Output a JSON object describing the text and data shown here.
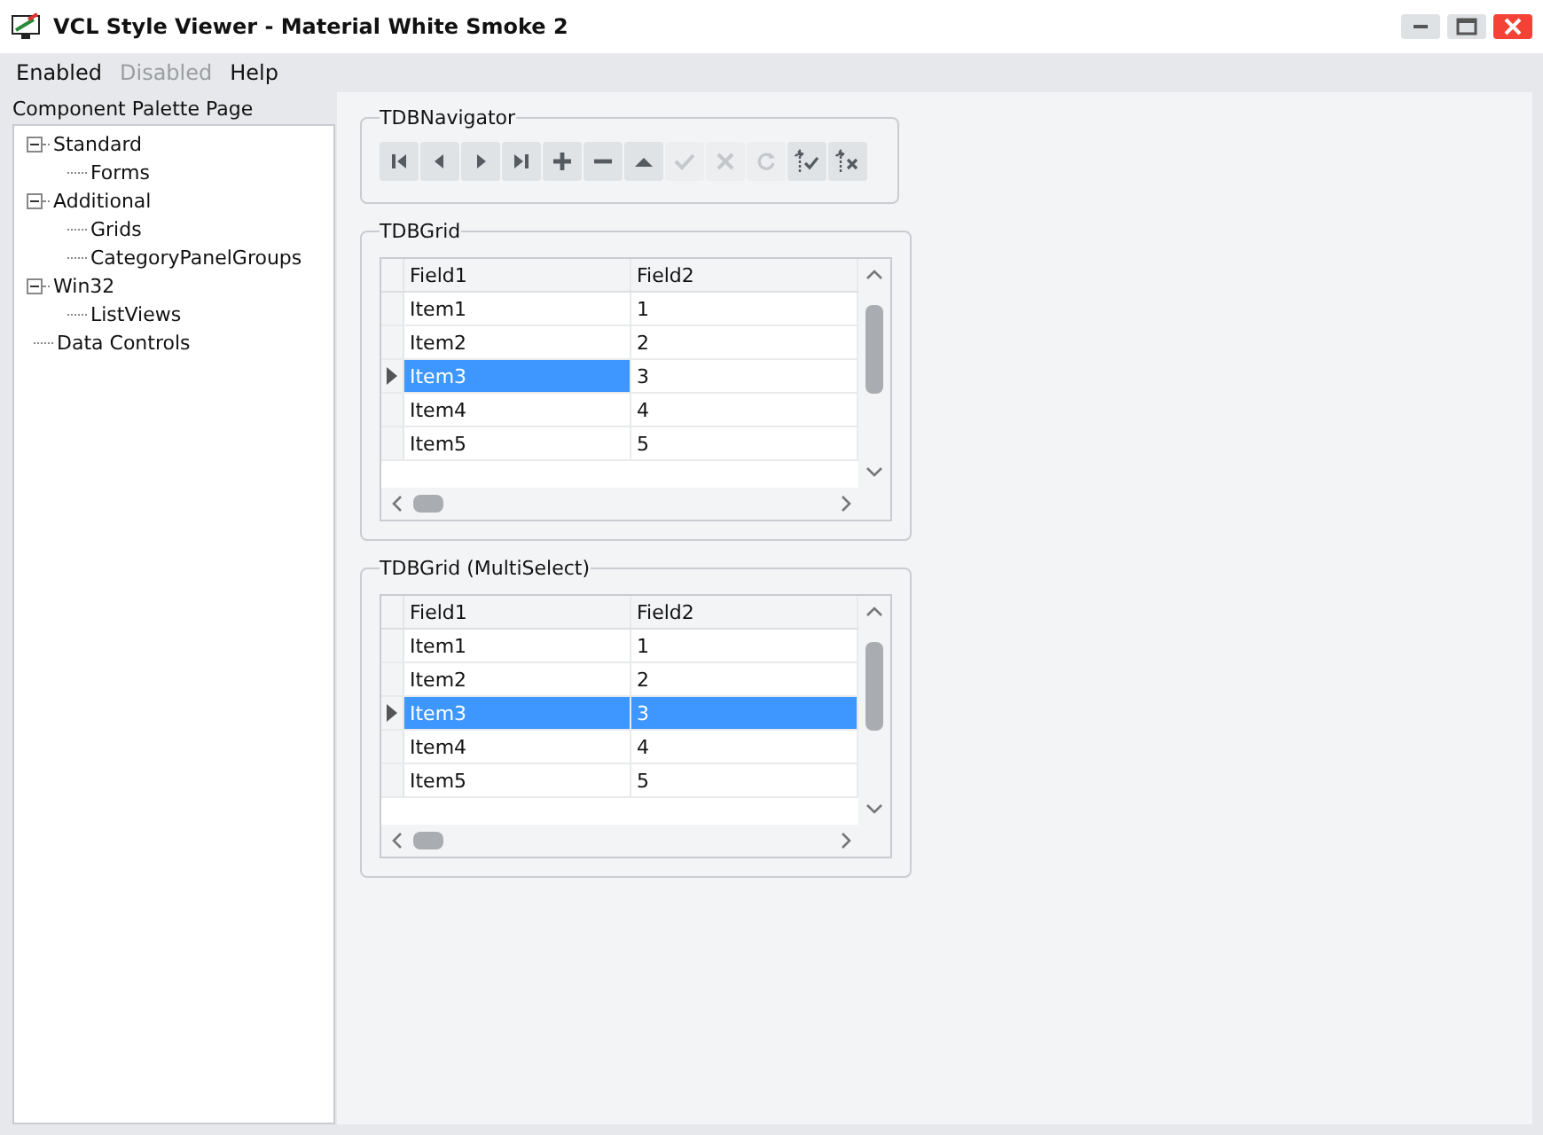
{
  "window": {
    "title": "VCL Style Viewer - Material White Smoke 2"
  },
  "menu": [
    {
      "label": "Enabled",
      "disabled": false
    },
    {
      "label": "Disabled",
      "disabled": true
    },
    {
      "label": "Help",
      "disabled": false
    }
  ],
  "sidebar": {
    "title": "Component Palette Page",
    "tree": [
      {
        "label": "Standard",
        "expanded": true,
        "children": [
          {
            "label": "Forms"
          }
        ]
      },
      {
        "label": "Additional",
        "expanded": true,
        "children": [
          {
            "label": "Grids"
          },
          {
            "label": "CategoryPanelGroups"
          }
        ]
      },
      {
        "label": "Win32",
        "expanded": true,
        "children": [
          {
            "label": "ListViews"
          }
        ]
      },
      {
        "label": "Data Controls"
      }
    ]
  },
  "navigator": {
    "title": "TDBNavigator",
    "buttons": [
      {
        "kind": "first",
        "disabled": false
      },
      {
        "kind": "prior",
        "disabled": false
      },
      {
        "kind": "next",
        "disabled": false
      },
      {
        "kind": "last",
        "disabled": false
      },
      {
        "kind": "insert",
        "disabled": false
      },
      {
        "kind": "delete",
        "disabled": false
      },
      {
        "kind": "edit",
        "disabled": false
      },
      {
        "kind": "post",
        "disabled": true
      },
      {
        "kind": "cancel",
        "disabled": true
      },
      {
        "kind": "refresh",
        "disabled": true
      },
      {
        "kind": "apply",
        "disabled": false
      },
      {
        "kind": "cancel_updates",
        "disabled": false
      }
    ]
  },
  "grids": [
    {
      "title": "TDBGrid",
      "row_select": false,
      "columns": [
        "Field1",
        "Field2"
      ],
      "rows": [
        {
          "cells": [
            "Item1",
            "1"
          ],
          "selected": false
        },
        {
          "cells": [
            "Item2",
            "2"
          ],
          "selected": false
        },
        {
          "cells": [
            "Item3",
            "3"
          ],
          "selected": true
        },
        {
          "cells": [
            "Item4",
            "4"
          ],
          "selected": false
        },
        {
          "cells": [
            "Item5",
            "5"
          ],
          "selected": false
        }
      ]
    },
    {
      "title": "TDBGrid (MultiSelect)",
      "row_select": true,
      "columns": [
        "Field1",
        "Field2"
      ],
      "rows": [
        {
          "cells": [
            "Item1",
            "1"
          ],
          "selected": false
        },
        {
          "cells": [
            "Item2",
            "2"
          ],
          "selected": false
        },
        {
          "cells": [
            "Item3",
            "3"
          ],
          "selected": true
        },
        {
          "cells": [
            "Item4",
            "4"
          ],
          "selected": false
        },
        {
          "cells": [
            "Item5",
            "5"
          ],
          "selected": false
        }
      ]
    }
  ]
}
